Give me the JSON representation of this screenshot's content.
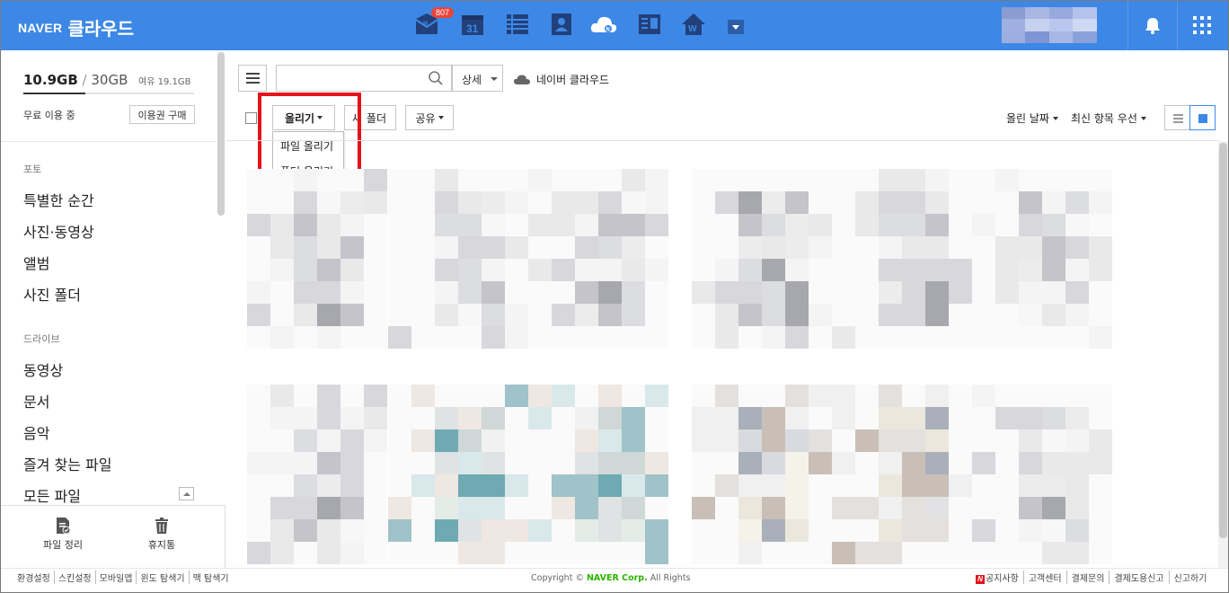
{
  "header": {
    "brand_naver": "NAVER",
    "brand_cloud": "클라우드",
    "mail_badge": "807",
    "calendar_day": "31",
    "services": [
      "mail-icon",
      "calendar-icon",
      "memo-icon",
      "contacts-icon",
      "cloud-icon",
      "office-icon",
      "blog-icon"
    ]
  },
  "sidebar": {
    "used": "10.9GB",
    "total": "30GB",
    "free": "여유 19.1GB",
    "usage_fraction": 0.363,
    "free_use": "무료 이용 중",
    "buy_label": "이용권 구매",
    "sections": [
      {
        "title": "포토",
        "items": [
          "특별한 순간",
          "사진·동영상",
          "앨범",
          "사진 폴더"
        ]
      },
      {
        "title": "드라이브",
        "items": [
          "동영상",
          "문서",
          "음악",
          "즐겨 찾는 파일",
          "모든 파일"
        ]
      }
    ],
    "bottom": {
      "organize": "파일 정리",
      "trash": "휴지통"
    }
  },
  "toolbar": {
    "search_placeholder": "",
    "detail_label": "상세",
    "cloud_label": "네이버 클라우드",
    "upload_label": "올리기",
    "folder_label": "폴더",
    "folder_prefix": "새",
    "share_label": "공유",
    "sort_date": "올린 날짜",
    "sort_order": "최신 항목 우선"
  },
  "upload_menu": {
    "items": [
      "파일 올리기",
      "폴더 올리기"
    ]
  },
  "footer": {
    "links_left": [
      "환경설정",
      "스킨설정",
      "모바일앱",
      "윈도 탐색기",
      "맥 탐색기"
    ],
    "copyright_prefix": "Copyright ©",
    "copyright_corp": "NAVER Corp.",
    "copyright_suffix": "All Rights",
    "links_right": [
      "공지사항",
      "고객센터",
      "결제문의",
      "결제도용신고",
      "신고하기"
    ]
  },
  "colors": {
    "topbar": "#3d88e6",
    "highlight": "#e3121b",
    "accent": "#3d88e6"
  }
}
